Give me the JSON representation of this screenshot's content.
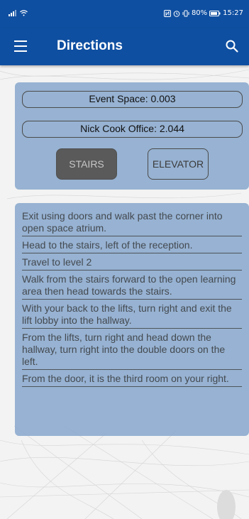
{
  "status_bar": {
    "battery_percent": "80%",
    "time": "15:27"
  },
  "app_bar": {
    "title": "Directions",
    "menu_icon": "menu-icon",
    "search_icon": "search-icon"
  },
  "route": {
    "from": "Event Space: 0.003",
    "to": "Nick Cook Office: 2.044"
  },
  "modes": {
    "stairs_label": "STAIRS",
    "elevator_label": "ELEVATOR",
    "selected": "STAIRS"
  },
  "steps": [
    "Exit using doors and walk past the corner into open space atrium.",
    "Head to the stairs, left of the reception.",
    "Travel to level 2",
    "Walk from the stairs forward to the open learning area then head towards the stairs.",
    "With your back to the lifts, turn right and exit the lift lobby into the hallway.",
    "From the lifts, turn right and head down the hallway, turn right into the double doors on the left.",
    "From the door, it is the third room on your right."
  ],
  "colors": {
    "primary": "#0f4fa1",
    "card": "#8aa8cd",
    "selected_button": "#5a5a5a"
  }
}
